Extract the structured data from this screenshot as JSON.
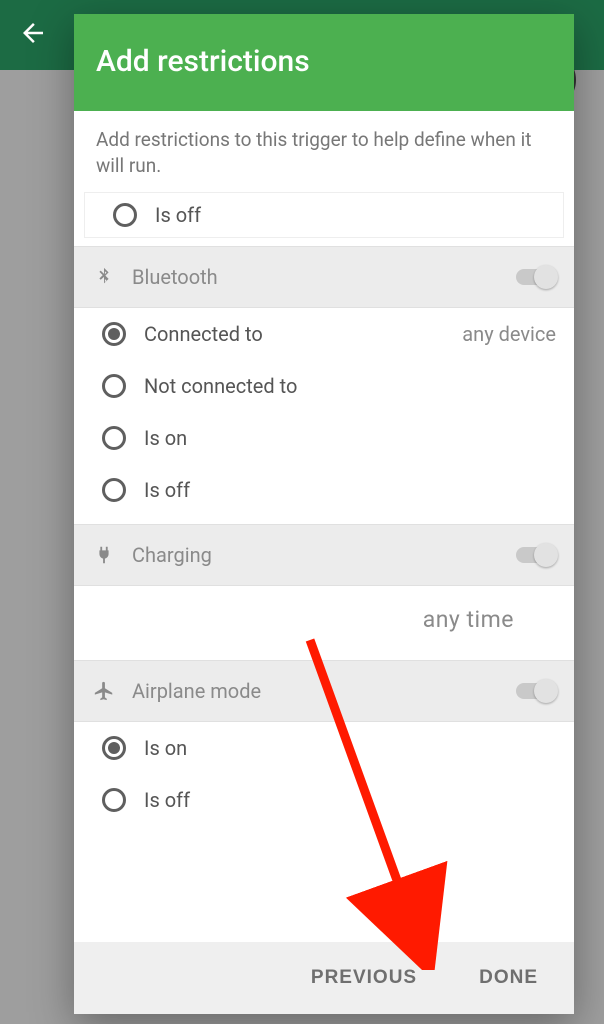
{
  "dialog": {
    "title": "Add restrictions",
    "description": "Add restrictions to this trigger to help define when it will run."
  },
  "partial_option": {
    "label": "Is off"
  },
  "sections": {
    "bluetooth": {
      "title": "Bluetooth",
      "toggle": false,
      "options": [
        {
          "label": "Connected to",
          "selected": true,
          "value": "any device"
        },
        {
          "label": "Not connected to",
          "selected": false
        },
        {
          "label": "Is on",
          "selected": false
        },
        {
          "label": "Is off",
          "selected": false
        }
      ]
    },
    "charging": {
      "title": "Charging",
      "toggle": false,
      "value": "any time"
    },
    "airplane": {
      "title": "Airplane mode",
      "toggle": false,
      "options": [
        {
          "label": "Is on",
          "selected": true
        },
        {
          "label": "Is off",
          "selected": false
        }
      ]
    }
  },
  "footer": {
    "previous": "PREVIOUS",
    "done": "DONE"
  }
}
